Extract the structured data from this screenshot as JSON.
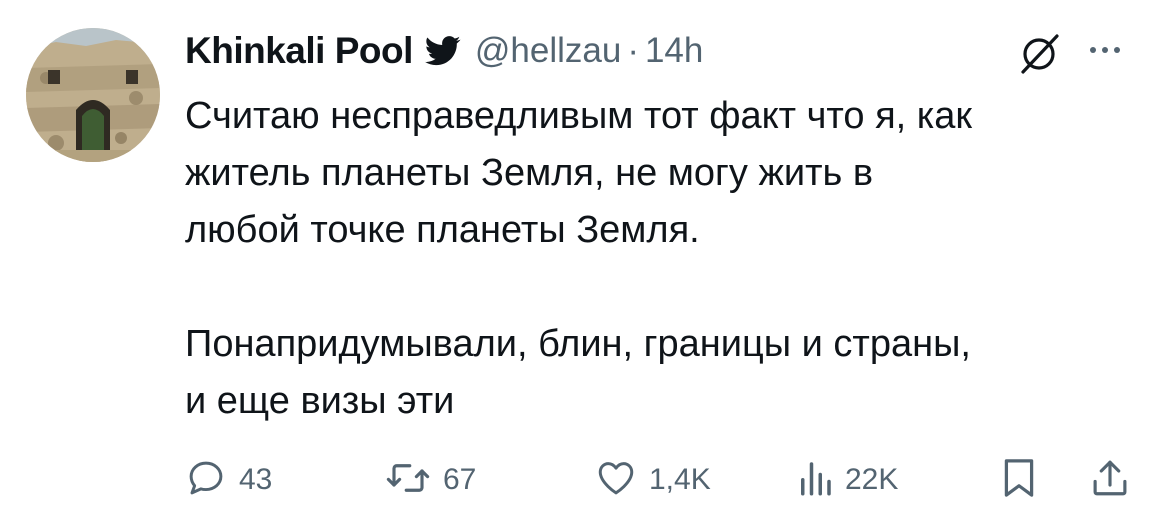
{
  "author": {
    "display_name": "Khinkali Pool",
    "handle": "@hellzau",
    "separator": "·",
    "time": "14h",
    "avatar_icon": "stone-ruin-avatar",
    "platform_icon": "twitter-bird-icon"
  },
  "tweet": {
    "text": "Считаю несправедливым тот факт что я, как\nжитель планеты Земля, не могу жить в\nлюбой точке планеты Земля.\n\nПонапридумывали, блин, границы и страны,\nи еще визы эти"
  },
  "actions": {
    "replies": "43",
    "retweets": "67",
    "likes": "1,4K",
    "views": "22K"
  },
  "colors": {
    "text_primary": "#0f1419",
    "text_secondary": "#536471",
    "background": "#ffffff"
  }
}
